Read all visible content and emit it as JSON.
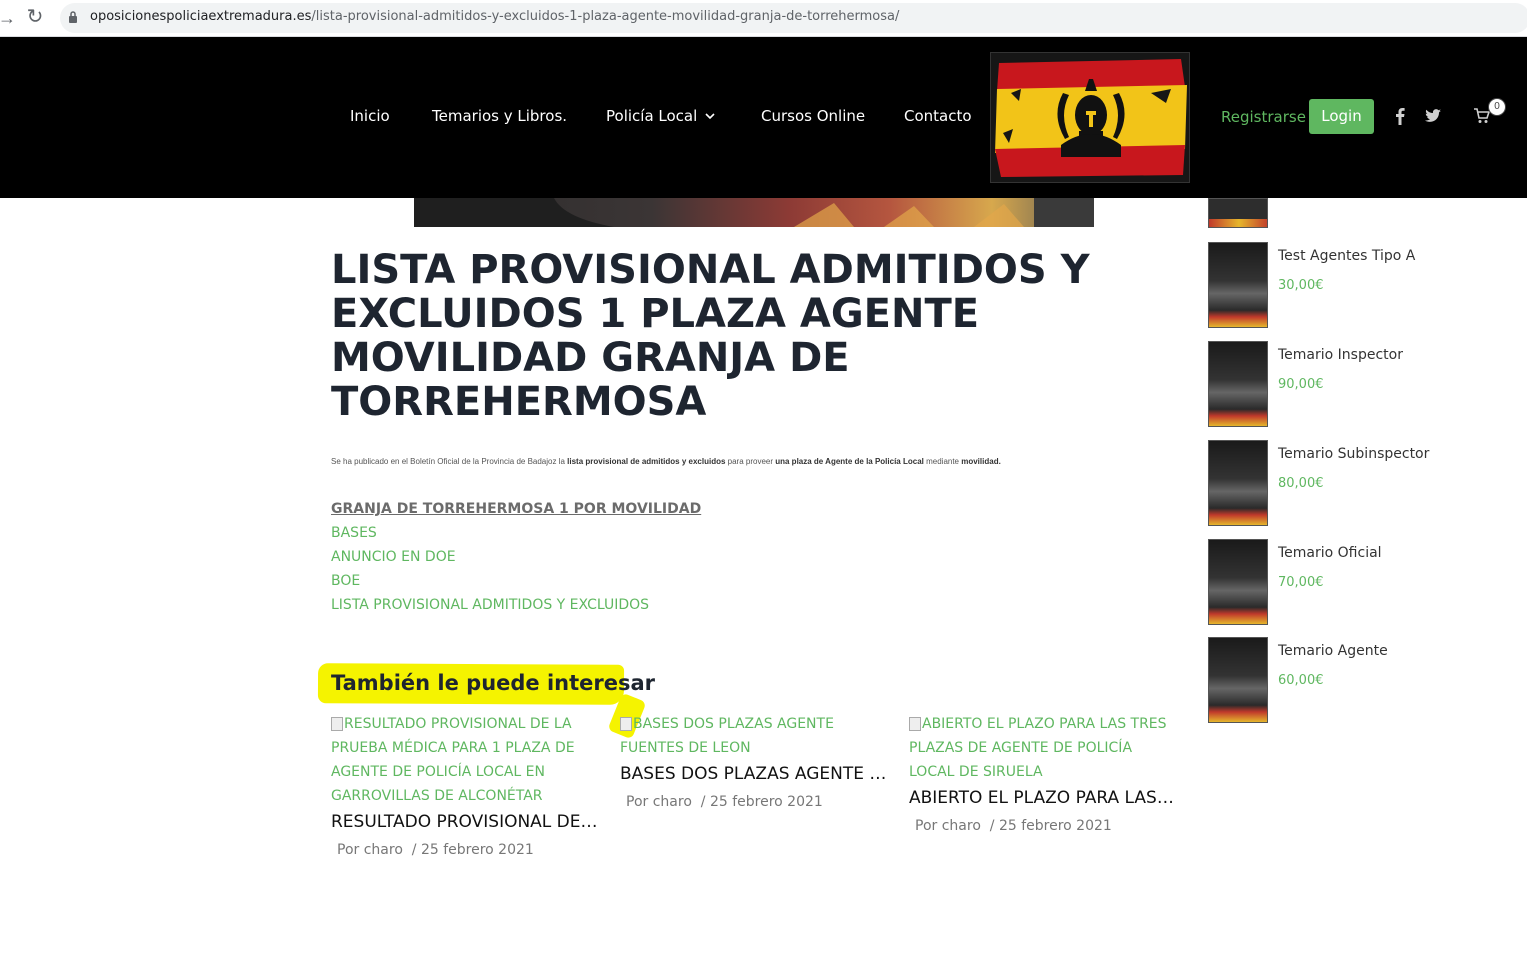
{
  "browser": {
    "url_domain": "oposicionespoliciaextremadura.es",
    "url_path": "/lista-provisional-admitidos-y-excluidos-1-plaza-agente-movilidad-granja-de-torrehermosa/"
  },
  "header": {
    "menu": [
      "Inicio",
      "Temarios y Libros.",
      "Policía Local",
      "Cursos Online",
      "Contacto"
    ],
    "register_label": "Registrarse",
    "login_label": "Login",
    "cart_count": "0",
    "brand_color": "#5fb760",
    "bg_color": "#000000"
  },
  "post": {
    "title": "LISTA PROVISIONAL ADMITIDOS Y EXCLUIDOS 1 PLAZA AGENTE MOVILIDAD GRANJA DE TORREHERMOSA",
    "intro_1": "Se ha publicado en el Boletín Oficial de la Provincia de Badajoz la ",
    "intro_b1": "lista provisional de admitidos y excluidos",
    "intro_2": " para proveer ",
    "intro_b2": "una plaza de Agente de la Policía Local",
    "intro_3": " mediante ",
    "intro_b3": "movilidad.",
    "links_heading": "GRANJA DE TORREHERMOSA 1 POR MOVILIDAD ",
    "links": [
      "BASES",
      "ANUNCIO EN DOE",
      "BOE",
      "LISTA PROVISIONAL ADMITIDOS Y EXCLUIDOS"
    ]
  },
  "related": {
    "title": "También le puede interesar",
    "items": [
      {
        "alt": "RESULTADO PROVISIONAL DE LA PRUEBA MÉDICA PARA 1 PLAZA DE AGENTE DE POLICÍA LOCAL EN GARROVILLAS DE ALCONÉTAR",
        "headline": "RESULTADO PROVISIONAL DE ...",
        "author": "Por charo",
        "date": "/ 25 febrero 2021"
      },
      {
        "alt": "BASES DOS PLAZAS AGENTE FUENTES DE LEON",
        "headline": "BASES DOS PLAZAS AGENTE F...",
        "author": "Por charo",
        "date": "/ 25 febrero 2021"
      },
      {
        "alt": "ABIERTO EL PLAZO PARA LAS TRES PLAZAS DE AGENTE DE POLICÍA LOCAL DE SIRUELA",
        "headline": "ABIERTO EL PLAZO PARA LAS ...",
        "author": "Por charo",
        "date": "/ 25 febrero 2021"
      }
    ]
  },
  "sidebar": {
    "products": [
      {
        "name": "Test Agentes Tipo A",
        "price": "30,00€"
      },
      {
        "name": "Temario Inspector",
        "price": "90,00€"
      },
      {
        "name": "Temario Subinspector",
        "price": "80,00€"
      },
      {
        "name": "Temario Oficial",
        "price": "70,00€"
      },
      {
        "name": "Temario Agente",
        "price": "60,00€"
      }
    ]
  }
}
